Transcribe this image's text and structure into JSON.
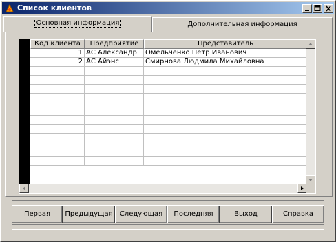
{
  "window": {
    "title": "Список клиентов"
  },
  "tabs": [
    {
      "label": "Основная информация",
      "active": true
    },
    {
      "label": "Дополнительная информация",
      "active": false
    }
  ],
  "grid": {
    "columns": [
      "Код клиента",
      "Предприятие",
      "Представитель"
    ],
    "rows": [
      {
        "code": "1",
        "company": "АС Александр",
        "representative": "Омельченко Петр Иванович"
      },
      {
        "code": "2",
        "company": "АС Айэнс",
        "representative": "Смирнова Людмила Михайловна"
      }
    ]
  },
  "buttons": {
    "first": "Первая",
    "prev": "Предыдущая",
    "next": "Следующая",
    "last": "Последняя",
    "exit": "Выход",
    "help": "Справка"
  },
  "colors": {
    "titlebar_start": "#0a246a",
    "titlebar_end": "#a6caf0",
    "face": "#d4d0c8"
  }
}
